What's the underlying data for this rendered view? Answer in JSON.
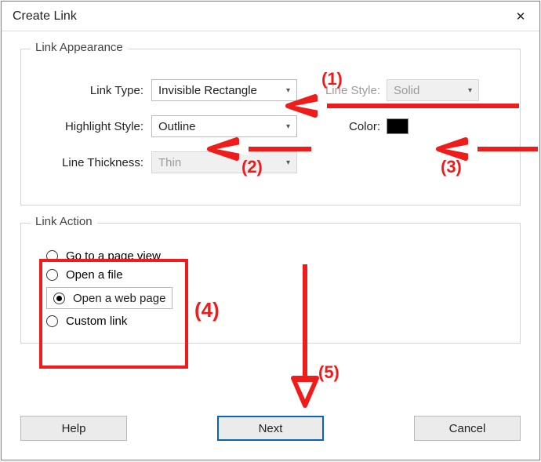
{
  "window": {
    "title": "Create Link",
    "close_glyph": "✕"
  },
  "groups": {
    "appearance_legend": "Link Appearance",
    "action_legend": "Link Action"
  },
  "fields": {
    "link_type_label": "Link Type:",
    "link_type_value": "Invisible Rectangle",
    "line_style_label": "Line Style:",
    "line_style_value": "Solid",
    "highlight_label": "Highlight Style:",
    "highlight_value": "Outline",
    "color_label": "Color:",
    "thickness_label": "Line Thickness:",
    "thickness_value": "Thin",
    "color_hex": "#000000",
    "chevron": "▾"
  },
  "radios": {
    "opt1": "Go to a page view",
    "opt2": "Open a file",
    "opt3": "Open a web page",
    "opt4": "Custom link",
    "selected": "opt3"
  },
  "buttons": {
    "help": "Help",
    "next": "Next",
    "cancel": "Cancel"
  },
  "annotations": {
    "a1": "(1)",
    "a2": "(2)",
    "a3": "(3)",
    "a4": "(4)",
    "a5": "(5)"
  }
}
